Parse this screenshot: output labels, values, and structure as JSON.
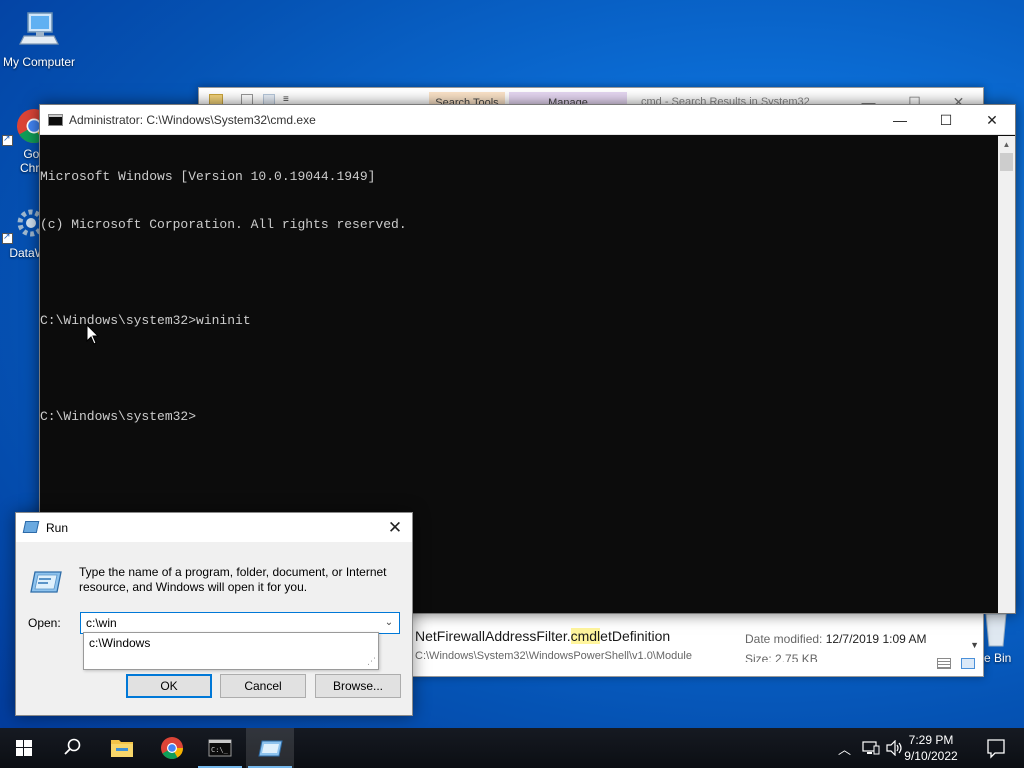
{
  "desktop": {
    "icons": [
      {
        "label": "My Computer"
      },
      {
        "label": "Goo"
      },
      {
        "label": "Chro"
      },
      {
        "label": "DataW"
      },
      {
        "label": "e Bin"
      }
    ]
  },
  "explorer_bg": {
    "tab_search_tools": "Search Tools",
    "tab_manage": "Manage",
    "title": "cmd - Search Results in System32",
    "result_name_pre": "NetFirewallAddressFilter.",
    "result_name_highlight": "cmdl",
    "result_name_post": "etDefinition",
    "result_path": "C:\\Windows\\System32\\WindowsPowerShell\\v1.0\\Module",
    "date_label": "Date modified:",
    "date_value": "12/7/2019 1:09 AM",
    "size_label": "Size:",
    "size_value": "2.75 KB"
  },
  "cmd": {
    "title": "Administrator: C:\\Windows\\System32\\cmd.exe",
    "lines": [
      "Microsoft Windows [Version 10.0.19044.1949]",
      "(c) Microsoft Corporation. All rights reserved.",
      "",
      "C:\\Windows\\system32>wininit",
      "",
      "C:\\Windows\\system32>"
    ]
  },
  "run": {
    "title": "Run",
    "description": "Type the name of a program, folder, document, or Internet resource, and Windows will open it for you.",
    "open_label": "Open:",
    "input_value": "c:\\win",
    "suggestion": "c:\\Windows",
    "ok": "OK",
    "cancel": "Cancel",
    "browse": "Browse..."
  },
  "taskbar": {
    "time": "7:29 PM",
    "date": "9/10/2022"
  },
  "colors": {
    "accent": "#0078d7",
    "console_bg": "#0c0c0c",
    "console_fg": "#cccccc",
    "highlight": "#fff59d"
  }
}
